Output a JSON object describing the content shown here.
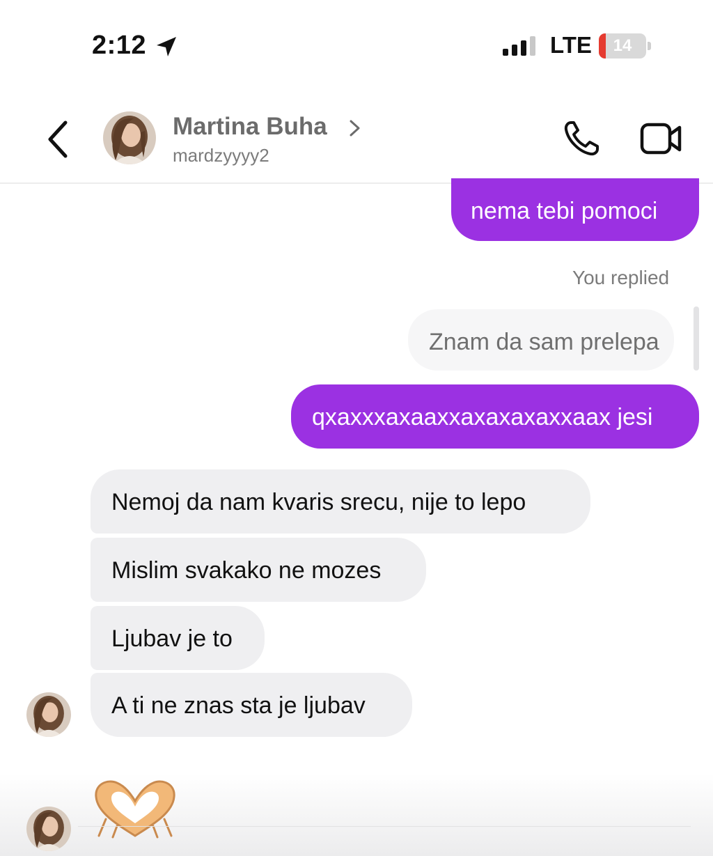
{
  "status_bar": {
    "time": "2:12",
    "network": "LTE",
    "battery_level": "14",
    "battery_fraction": 0.14,
    "battery_color": "#e53b30",
    "icons": [
      "location-arrow-icon",
      "cellular-signal-icon",
      "battery-icon"
    ]
  },
  "header": {
    "contact_name": "Martina Buha",
    "username": "mardzyyyy2",
    "icons": [
      "back-chevron-icon",
      "avatar",
      "chevron-right-icon",
      "phone-icon",
      "video-camera-icon"
    ]
  },
  "conversation": {
    "sent_color": "#9b31e2",
    "received_color": "#efeff1",
    "sent_1": "nema tebi pomoci",
    "reply_caption": "You replied",
    "reply_quote": "Znam da sam prelepa",
    "sent_2": "qxaxxxaxaaxxaxaxaxaxxaax jesi",
    "received": [
      "Nemoj da nam kvaris srecu, nije to lepo",
      "Mislim svakako ne mozes",
      "Ljubav je to",
      "A ti ne znas sta je ljubav"
    ],
    "emoji_reaction": "heart-hands-emoji"
  }
}
